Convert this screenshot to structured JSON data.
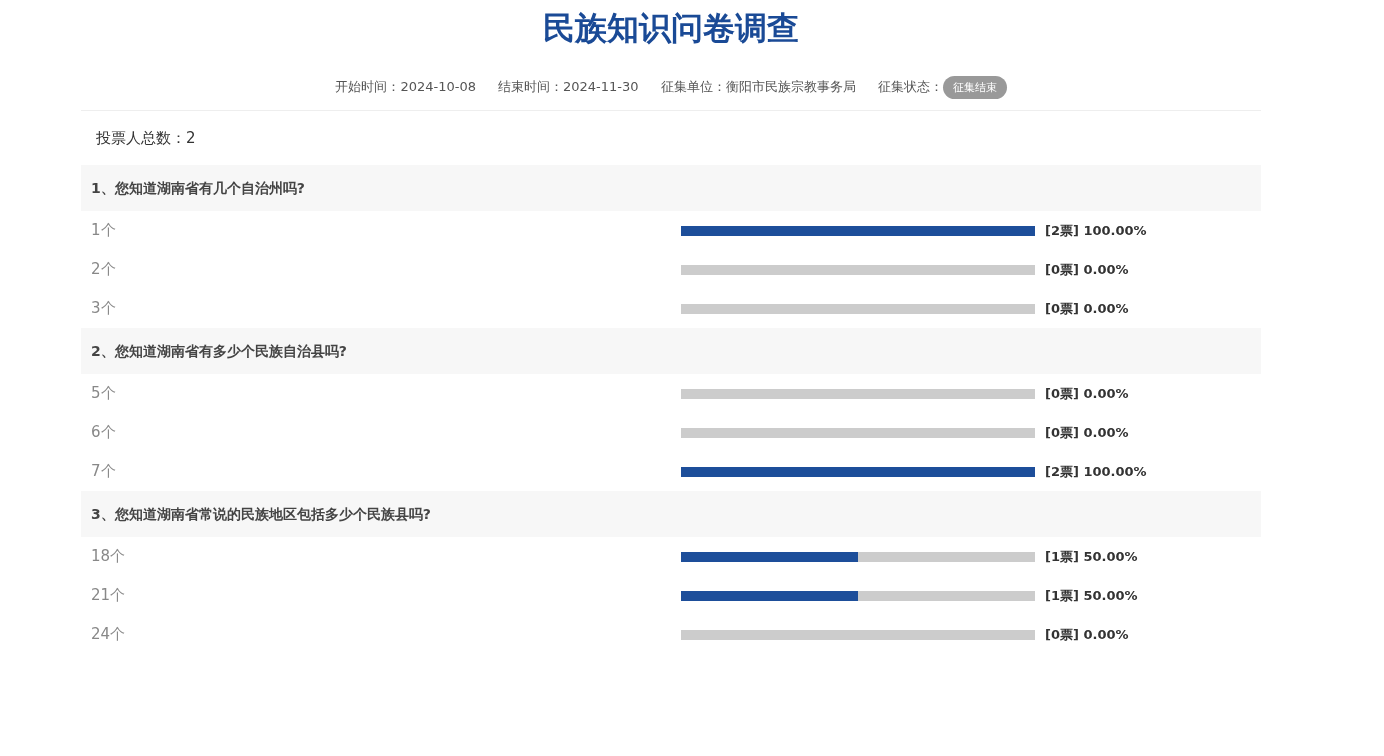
{
  "title": "民族知识问卷调查",
  "meta": [
    {
      "label": "开始时间：",
      "value": "2024-10-08"
    },
    {
      "label": "结束时间：",
      "value": "2024-11-30"
    },
    {
      "label": "征集单位：",
      "value": "衡阳市民族宗教事务局"
    }
  ],
  "status": {
    "label": "征集状态：",
    "badge": "征集结束"
  },
  "total": {
    "label": "投票人总数：",
    "value": "2"
  },
  "questions": [
    {
      "title": "1、您知道湖南省有几个自治州吗?",
      "options": [
        {
          "label": "1个",
          "level": 1,
          "result": "[2票] 100.00%"
        },
        {
          "label": "2个",
          "level": 0,
          "result": "[0票] 0.00%"
        },
        {
          "label": "3个",
          "level": 0,
          "result": "[0票] 0.00%"
        }
      ]
    },
    {
      "title": "2、您知道湖南省有多少个民族自治县吗?",
      "options": [
        {
          "label": "5个",
          "level": 0,
          "result": "[0票] 0.00%"
        },
        {
          "label": "6个",
          "level": 0,
          "result": "[0票] 0.00%"
        },
        {
          "label": "7个",
          "level": 1,
          "result": "[2票] 100.00%"
        }
      ]
    },
    {
      "title": "3、您知道湖南省常说的民族地区包括多少个民族县吗?",
      "options": [
        {
          "label": "18个",
          "level": 0.5,
          "result": "[1票] 50.00%"
        },
        {
          "label": "21个",
          "level": 0.5,
          "result": "[1票] 50.00%"
        },
        {
          "label": "24个",
          "level": 0,
          "result": "[0票] 0.00%"
        }
      ]
    }
  ]
}
